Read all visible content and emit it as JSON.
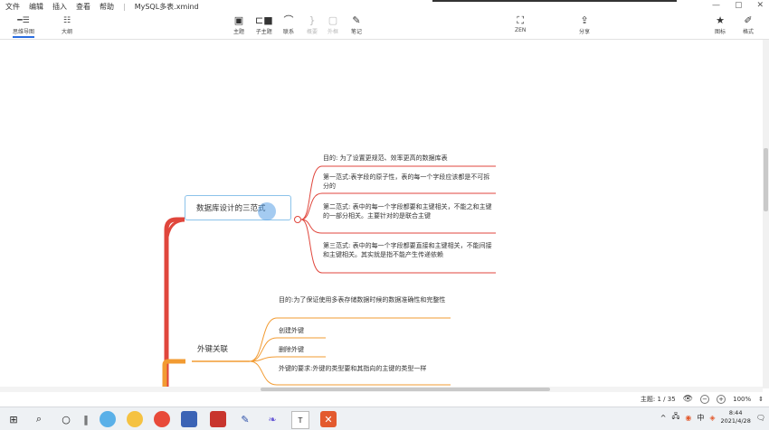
{
  "menu": [
    "文件",
    "编辑",
    "插入",
    "查看",
    "帮助"
  ],
  "file_name": "MySQL多表.xmind",
  "window_controls": {
    "minimize": "—",
    "maximize": "▢",
    "close": "✕"
  },
  "view_tabs": [
    {
      "label": "思维导图",
      "icon": "mindmap-icon",
      "active": true
    },
    {
      "label": "大纲",
      "icon": "outline-icon",
      "active": false
    }
  ],
  "toolbar": {
    "topic": "主题",
    "subtopic": "子主题",
    "relationship": "联系",
    "summary": "概要",
    "boundary": "外框",
    "note": "笔记",
    "zen": "ZEN",
    "share": "分享",
    "icons": "图标",
    "format": "格式"
  },
  "central_topic": "数据库设计的三范式",
  "branch1_items": [
    "目的: 为了设置更规范、效率更高的数据库表",
    "第一范式:表字段的原子性，表的每一个字段应该都是不可拆分的",
    "第二范式: 表中的每一个字段都要和主键相关，不能之和主键的一部分相关。主要针对的是联合主键",
    "第三范式: 表中的每一个字段都要直接和主键相关，不能间接和主键相关。其实就是指不能产生传递依赖"
  ],
  "foreign_key_topic": "外键关联",
  "branch2_items": [
    "目的:为了保证使用多表存储数据时候的数据准确性和完整性",
    "创建外键",
    "删除外键",
    "外键的要求:外键的类型要和其指向的主键的类型一样"
  ],
  "status": {
    "topic_count": "主题: 1 / 35",
    "zoom_minus": "−",
    "zoom_plus": "+",
    "zoom": "100%"
  },
  "taskbar": {
    "time": "8:44",
    "date": "2021/4/28",
    "ime": "中"
  },
  "colors": {
    "branch_red": "#e0463c",
    "branch_orange": "#f29b32",
    "accent": "#2a6de0"
  }
}
